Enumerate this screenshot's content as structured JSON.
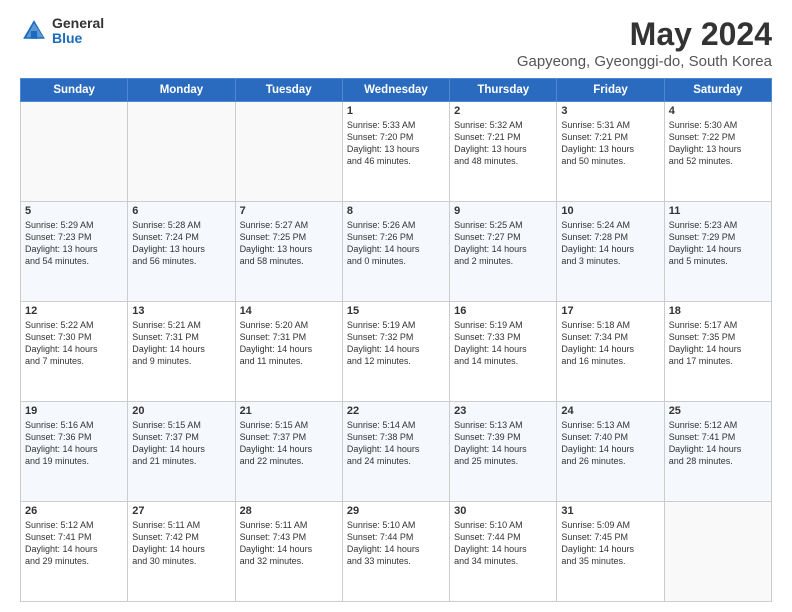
{
  "header": {
    "logo_general": "General",
    "logo_blue": "Blue",
    "main_title": "May 2024",
    "subtitle": "Gapyeong, Gyeonggi-do, South Korea"
  },
  "days_of_week": [
    "Sunday",
    "Monday",
    "Tuesday",
    "Wednesday",
    "Thursday",
    "Friday",
    "Saturday"
  ],
  "weeks": [
    [
      {
        "num": "",
        "text": ""
      },
      {
        "num": "",
        "text": ""
      },
      {
        "num": "",
        "text": ""
      },
      {
        "num": "1",
        "text": "Sunrise: 5:33 AM\nSunset: 7:20 PM\nDaylight: 13 hours\nand 46 minutes."
      },
      {
        "num": "2",
        "text": "Sunrise: 5:32 AM\nSunset: 7:21 PM\nDaylight: 13 hours\nand 48 minutes."
      },
      {
        "num": "3",
        "text": "Sunrise: 5:31 AM\nSunset: 7:21 PM\nDaylight: 13 hours\nand 50 minutes."
      },
      {
        "num": "4",
        "text": "Sunrise: 5:30 AM\nSunset: 7:22 PM\nDaylight: 13 hours\nand 52 minutes."
      }
    ],
    [
      {
        "num": "5",
        "text": "Sunrise: 5:29 AM\nSunset: 7:23 PM\nDaylight: 13 hours\nand 54 minutes."
      },
      {
        "num": "6",
        "text": "Sunrise: 5:28 AM\nSunset: 7:24 PM\nDaylight: 13 hours\nand 56 minutes."
      },
      {
        "num": "7",
        "text": "Sunrise: 5:27 AM\nSunset: 7:25 PM\nDaylight: 13 hours\nand 58 minutes."
      },
      {
        "num": "8",
        "text": "Sunrise: 5:26 AM\nSunset: 7:26 PM\nDaylight: 14 hours\nand 0 minutes."
      },
      {
        "num": "9",
        "text": "Sunrise: 5:25 AM\nSunset: 7:27 PM\nDaylight: 14 hours\nand 2 minutes."
      },
      {
        "num": "10",
        "text": "Sunrise: 5:24 AM\nSunset: 7:28 PM\nDaylight: 14 hours\nand 3 minutes."
      },
      {
        "num": "11",
        "text": "Sunrise: 5:23 AM\nSunset: 7:29 PM\nDaylight: 14 hours\nand 5 minutes."
      }
    ],
    [
      {
        "num": "12",
        "text": "Sunrise: 5:22 AM\nSunset: 7:30 PM\nDaylight: 14 hours\nand 7 minutes."
      },
      {
        "num": "13",
        "text": "Sunrise: 5:21 AM\nSunset: 7:31 PM\nDaylight: 14 hours\nand 9 minutes."
      },
      {
        "num": "14",
        "text": "Sunrise: 5:20 AM\nSunset: 7:31 PM\nDaylight: 14 hours\nand 11 minutes."
      },
      {
        "num": "15",
        "text": "Sunrise: 5:19 AM\nSunset: 7:32 PM\nDaylight: 14 hours\nand 12 minutes."
      },
      {
        "num": "16",
        "text": "Sunrise: 5:19 AM\nSunset: 7:33 PM\nDaylight: 14 hours\nand 14 minutes."
      },
      {
        "num": "17",
        "text": "Sunrise: 5:18 AM\nSunset: 7:34 PM\nDaylight: 14 hours\nand 16 minutes."
      },
      {
        "num": "18",
        "text": "Sunrise: 5:17 AM\nSunset: 7:35 PM\nDaylight: 14 hours\nand 17 minutes."
      }
    ],
    [
      {
        "num": "19",
        "text": "Sunrise: 5:16 AM\nSunset: 7:36 PM\nDaylight: 14 hours\nand 19 minutes."
      },
      {
        "num": "20",
        "text": "Sunrise: 5:15 AM\nSunset: 7:37 PM\nDaylight: 14 hours\nand 21 minutes."
      },
      {
        "num": "21",
        "text": "Sunrise: 5:15 AM\nSunset: 7:37 PM\nDaylight: 14 hours\nand 22 minutes."
      },
      {
        "num": "22",
        "text": "Sunrise: 5:14 AM\nSunset: 7:38 PM\nDaylight: 14 hours\nand 24 minutes."
      },
      {
        "num": "23",
        "text": "Sunrise: 5:13 AM\nSunset: 7:39 PM\nDaylight: 14 hours\nand 25 minutes."
      },
      {
        "num": "24",
        "text": "Sunrise: 5:13 AM\nSunset: 7:40 PM\nDaylight: 14 hours\nand 26 minutes."
      },
      {
        "num": "25",
        "text": "Sunrise: 5:12 AM\nSunset: 7:41 PM\nDaylight: 14 hours\nand 28 minutes."
      }
    ],
    [
      {
        "num": "26",
        "text": "Sunrise: 5:12 AM\nSunset: 7:41 PM\nDaylight: 14 hours\nand 29 minutes."
      },
      {
        "num": "27",
        "text": "Sunrise: 5:11 AM\nSunset: 7:42 PM\nDaylight: 14 hours\nand 30 minutes."
      },
      {
        "num": "28",
        "text": "Sunrise: 5:11 AM\nSunset: 7:43 PM\nDaylight: 14 hours\nand 32 minutes."
      },
      {
        "num": "29",
        "text": "Sunrise: 5:10 AM\nSunset: 7:44 PM\nDaylight: 14 hours\nand 33 minutes."
      },
      {
        "num": "30",
        "text": "Sunrise: 5:10 AM\nSunset: 7:44 PM\nDaylight: 14 hours\nand 34 minutes."
      },
      {
        "num": "31",
        "text": "Sunrise: 5:09 AM\nSunset: 7:45 PM\nDaylight: 14 hours\nand 35 minutes."
      },
      {
        "num": "",
        "text": ""
      }
    ]
  ]
}
